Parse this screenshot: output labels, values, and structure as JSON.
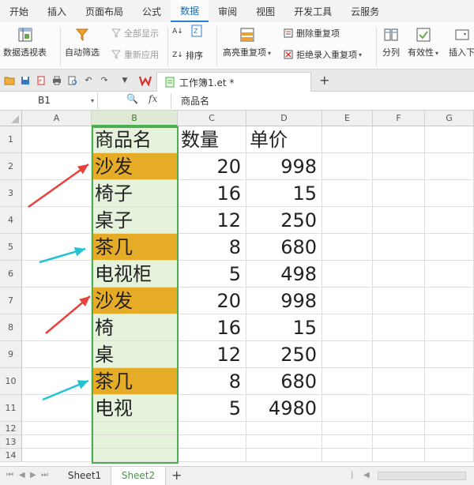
{
  "tabs": [
    "开始",
    "插入",
    "页面布局",
    "公式",
    "数据",
    "审阅",
    "视图",
    "开发工具",
    "云服务"
  ],
  "active_tab": "数据",
  "ribbon": {
    "pivot": "数据透视表",
    "autofilter": "自动筛选",
    "show_all": "全部显示",
    "reapply": "重新应用",
    "sort": "排序",
    "highlight_dup": "高亮重复项",
    "remove_dup": "删除重复项",
    "reject_dup": "拒绝录入重复项",
    "split": "分列",
    "validity": "有效性",
    "insert_dropdown": "插入下"
  },
  "doc_tab": "工作簿1.et *",
  "name_box": "B1",
  "fx": "fx",
  "formula": "商品名",
  "columns": [
    "A",
    "B",
    "C",
    "D",
    "E",
    "F",
    "G"
  ],
  "rows": [
    "1",
    "2",
    "3",
    "4",
    "5",
    "6",
    "7",
    "8",
    "9",
    "10",
    "11",
    "12",
    "13",
    "14"
  ],
  "table": [
    {
      "b": "商品名",
      "c": "数量",
      "d": "单价"
    },
    {
      "b": "沙发",
      "c": "20",
      "d": "998"
    },
    {
      "b": "椅子",
      "c": "16",
      "d": "15"
    },
    {
      "b": "桌子",
      "c": "12",
      "d": "250"
    },
    {
      "b": "茶几",
      "c": "8",
      "d": "680"
    },
    {
      "b": "电视柜",
      "c": "5",
      "d": "498"
    },
    {
      "b": "沙发",
      "c": "20",
      "d": "998"
    },
    {
      "b": "椅",
      "c": "16",
      "d": "15"
    },
    {
      "b": "桌",
      "c": "12",
      "d": "250"
    },
    {
      "b": "茶几",
      "c": "8",
      "d": "680"
    },
    {
      "b": "电视",
      "c": "5",
      "d": "4980"
    }
  ],
  "sheets": [
    "Sheet1",
    "Sheet2"
  ],
  "active_sheet": "Sheet2",
  "colors": {
    "highlight": "#e6ab27",
    "selection": "#4caf50",
    "red_arrow": "#e8413a",
    "cyan_arrow": "#22c4d4"
  }
}
